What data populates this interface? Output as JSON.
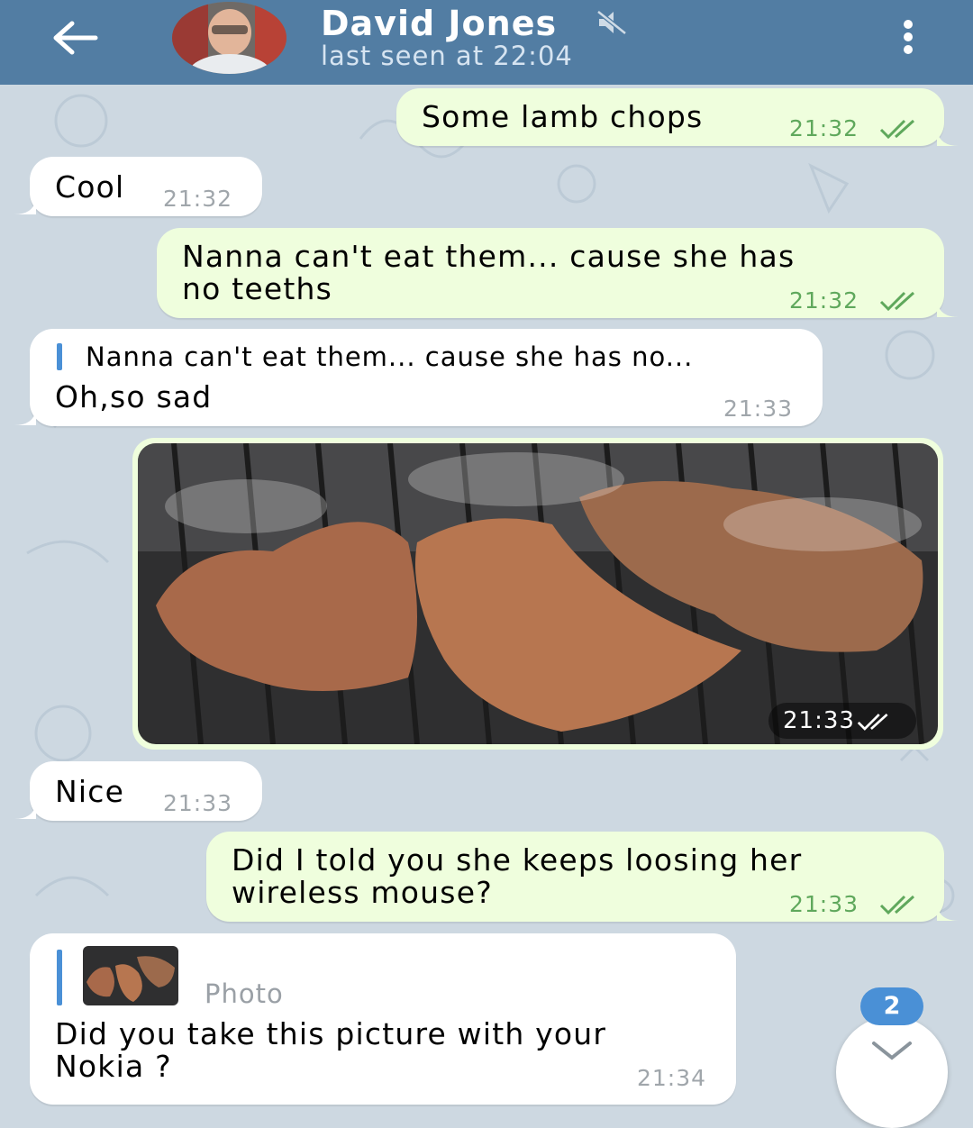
{
  "header": {
    "contact_name": "David Jones",
    "status": "last seen at 22:04",
    "bg_color": "#527da3"
  },
  "icons": {
    "back": "arrow-left-icon",
    "muted": "muted-speaker-icon",
    "menu": "more-vertical-icon",
    "read": "double-check-icon",
    "scroll_down": "chevron-down-icon"
  },
  "messages": [
    {
      "side": "out",
      "text": "Some lamb chops",
      "time": "21:32"
    },
    {
      "side": "in",
      "text": "Cool",
      "time": "21:32"
    },
    {
      "side": "out",
      "line1": "Nanna can't eat them... cause she has",
      "line2": "no teeths",
      "time": "21:32"
    },
    {
      "side": "in",
      "reply_preview": "Nanna can't eat them... cause she has no...",
      "text": "Oh,so sad",
      "time": "21:33"
    },
    {
      "side": "out",
      "type": "photo",
      "time": "21:33"
    },
    {
      "side": "in",
      "text": "Nice",
      "time": "21:33"
    },
    {
      "side": "out",
      "line1": "Did I told you she keeps loosing her",
      "line2": "wireless mouse?",
      "time": "21:33"
    },
    {
      "side": "in",
      "reply_label": "Photo",
      "line1": "Did you take this picture with your",
      "line2": "Nokia ?",
      "time": "21:34"
    }
  ],
  "scroll_fab": {
    "unread_count": "2"
  },
  "colors": {
    "outgoing_bubble": "#effedd",
    "incoming_bubble": "#ffffff",
    "chat_background": "#cdd8e1",
    "accent": "#4a90d6",
    "read_check": "#5fa85c"
  }
}
